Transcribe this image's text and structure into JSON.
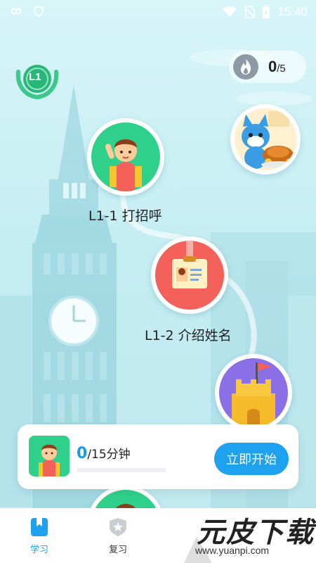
{
  "status_bar": {
    "time": "15:40"
  },
  "streak": {
    "count": "0",
    "total": "/5"
  },
  "level_badge": {
    "text": "L1"
  },
  "lessons": [
    {
      "label": "L1-1 打招呼"
    },
    {
      "label": "L1-2 介绍姓名"
    }
  ],
  "task_card": {
    "progress_value": "0",
    "progress_rest": "/15分钟",
    "progress_fraction": 0,
    "start_label": "立即开始"
  },
  "tabs": [
    {
      "label": "学习",
      "active": true
    },
    {
      "label": "复习",
      "active": false
    }
  ],
  "watermark": {
    "text": "元皮下载",
    "url": "www.yuanpi.com"
  },
  "colors": {
    "accent": "#1ea2ef",
    "node_green": "#2fd08a",
    "node_red": "#f4605a",
    "node_purple": "#8b6fe6"
  }
}
